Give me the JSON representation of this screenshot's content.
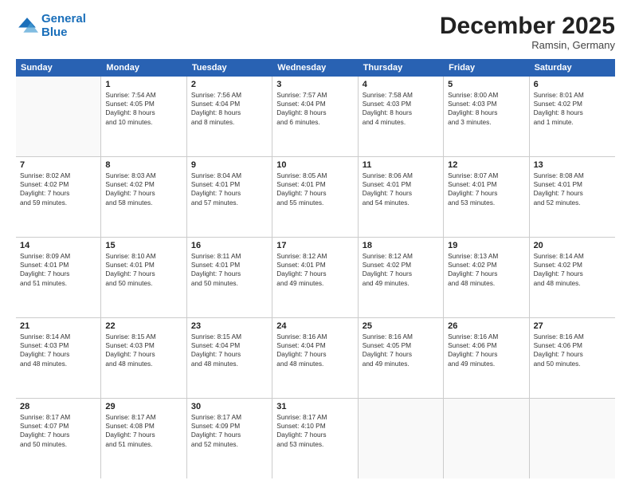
{
  "logo": {
    "line1": "General",
    "line2": "Blue"
  },
  "title": "December 2025",
  "location": "Ramsin, Germany",
  "header_days": [
    "Sunday",
    "Monday",
    "Tuesday",
    "Wednesday",
    "Thursday",
    "Friday",
    "Saturday"
  ],
  "weeks": [
    [
      {
        "day": "",
        "lines": []
      },
      {
        "day": "1",
        "lines": [
          "Sunrise: 7:54 AM",
          "Sunset: 4:05 PM",
          "Daylight: 8 hours",
          "and 10 minutes."
        ]
      },
      {
        "day": "2",
        "lines": [
          "Sunrise: 7:56 AM",
          "Sunset: 4:04 PM",
          "Daylight: 8 hours",
          "and 8 minutes."
        ]
      },
      {
        "day": "3",
        "lines": [
          "Sunrise: 7:57 AM",
          "Sunset: 4:04 PM",
          "Daylight: 8 hours",
          "and 6 minutes."
        ]
      },
      {
        "day": "4",
        "lines": [
          "Sunrise: 7:58 AM",
          "Sunset: 4:03 PM",
          "Daylight: 8 hours",
          "and 4 minutes."
        ]
      },
      {
        "day": "5",
        "lines": [
          "Sunrise: 8:00 AM",
          "Sunset: 4:03 PM",
          "Daylight: 8 hours",
          "and 3 minutes."
        ]
      },
      {
        "day": "6",
        "lines": [
          "Sunrise: 8:01 AM",
          "Sunset: 4:02 PM",
          "Daylight: 8 hours",
          "and 1 minute."
        ]
      }
    ],
    [
      {
        "day": "7",
        "lines": [
          "Sunrise: 8:02 AM",
          "Sunset: 4:02 PM",
          "Daylight: 7 hours",
          "and 59 minutes."
        ]
      },
      {
        "day": "8",
        "lines": [
          "Sunrise: 8:03 AM",
          "Sunset: 4:02 PM",
          "Daylight: 7 hours",
          "and 58 minutes."
        ]
      },
      {
        "day": "9",
        "lines": [
          "Sunrise: 8:04 AM",
          "Sunset: 4:01 PM",
          "Daylight: 7 hours",
          "and 57 minutes."
        ]
      },
      {
        "day": "10",
        "lines": [
          "Sunrise: 8:05 AM",
          "Sunset: 4:01 PM",
          "Daylight: 7 hours",
          "and 55 minutes."
        ]
      },
      {
        "day": "11",
        "lines": [
          "Sunrise: 8:06 AM",
          "Sunset: 4:01 PM",
          "Daylight: 7 hours",
          "and 54 minutes."
        ]
      },
      {
        "day": "12",
        "lines": [
          "Sunrise: 8:07 AM",
          "Sunset: 4:01 PM",
          "Daylight: 7 hours",
          "and 53 minutes."
        ]
      },
      {
        "day": "13",
        "lines": [
          "Sunrise: 8:08 AM",
          "Sunset: 4:01 PM",
          "Daylight: 7 hours",
          "and 52 minutes."
        ]
      }
    ],
    [
      {
        "day": "14",
        "lines": [
          "Sunrise: 8:09 AM",
          "Sunset: 4:01 PM",
          "Daylight: 7 hours",
          "and 51 minutes."
        ]
      },
      {
        "day": "15",
        "lines": [
          "Sunrise: 8:10 AM",
          "Sunset: 4:01 PM",
          "Daylight: 7 hours",
          "and 50 minutes."
        ]
      },
      {
        "day": "16",
        "lines": [
          "Sunrise: 8:11 AM",
          "Sunset: 4:01 PM",
          "Daylight: 7 hours",
          "and 50 minutes."
        ]
      },
      {
        "day": "17",
        "lines": [
          "Sunrise: 8:12 AM",
          "Sunset: 4:01 PM",
          "Daylight: 7 hours",
          "and 49 minutes."
        ]
      },
      {
        "day": "18",
        "lines": [
          "Sunrise: 8:12 AM",
          "Sunset: 4:02 PM",
          "Daylight: 7 hours",
          "and 49 minutes."
        ]
      },
      {
        "day": "19",
        "lines": [
          "Sunrise: 8:13 AM",
          "Sunset: 4:02 PM",
          "Daylight: 7 hours",
          "and 48 minutes."
        ]
      },
      {
        "day": "20",
        "lines": [
          "Sunrise: 8:14 AM",
          "Sunset: 4:02 PM",
          "Daylight: 7 hours",
          "and 48 minutes."
        ]
      }
    ],
    [
      {
        "day": "21",
        "lines": [
          "Sunrise: 8:14 AM",
          "Sunset: 4:03 PM",
          "Daylight: 7 hours",
          "and 48 minutes."
        ]
      },
      {
        "day": "22",
        "lines": [
          "Sunrise: 8:15 AM",
          "Sunset: 4:03 PM",
          "Daylight: 7 hours",
          "and 48 minutes."
        ]
      },
      {
        "day": "23",
        "lines": [
          "Sunrise: 8:15 AM",
          "Sunset: 4:04 PM",
          "Daylight: 7 hours",
          "and 48 minutes."
        ]
      },
      {
        "day": "24",
        "lines": [
          "Sunrise: 8:16 AM",
          "Sunset: 4:04 PM",
          "Daylight: 7 hours",
          "and 48 minutes."
        ]
      },
      {
        "day": "25",
        "lines": [
          "Sunrise: 8:16 AM",
          "Sunset: 4:05 PM",
          "Daylight: 7 hours",
          "and 49 minutes."
        ]
      },
      {
        "day": "26",
        "lines": [
          "Sunrise: 8:16 AM",
          "Sunset: 4:06 PM",
          "Daylight: 7 hours",
          "and 49 minutes."
        ]
      },
      {
        "day": "27",
        "lines": [
          "Sunrise: 8:16 AM",
          "Sunset: 4:06 PM",
          "Daylight: 7 hours",
          "and 50 minutes."
        ]
      }
    ],
    [
      {
        "day": "28",
        "lines": [
          "Sunrise: 8:17 AM",
          "Sunset: 4:07 PM",
          "Daylight: 7 hours",
          "and 50 minutes."
        ]
      },
      {
        "day": "29",
        "lines": [
          "Sunrise: 8:17 AM",
          "Sunset: 4:08 PM",
          "Daylight: 7 hours",
          "and 51 minutes."
        ]
      },
      {
        "day": "30",
        "lines": [
          "Sunrise: 8:17 AM",
          "Sunset: 4:09 PM",
          "Daylight: 7 hours",
          "and 52 minutes."
        ]
      },
      {
        "day": "31",
        "lines": [
          "Sunrise: 8:17 AM",
          "Sunset: 4:10 PM",
          "Daylight: 7 hours",
          "and 53 minutes."
        ]
      },
      {
        "day": "",
        "lines": []
      },
      {
        "day": "",
        "lines": []
      },
      {
        "day": "",
        "lines": []
      }
    ]
  ]
}
